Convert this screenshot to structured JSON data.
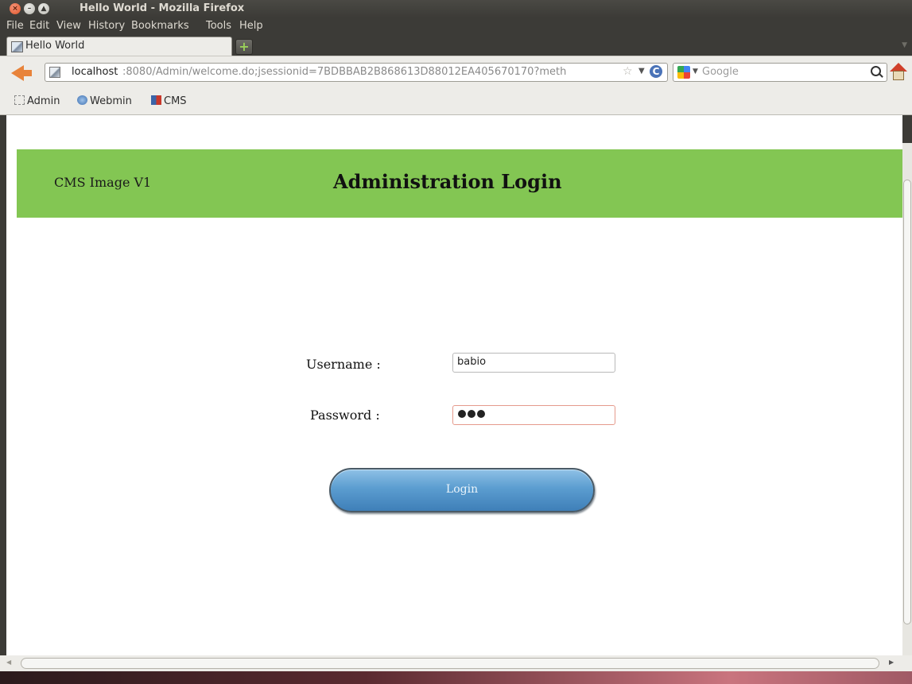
{
  "window": {
    "title": "Hello World - Mozilla Firefox"
  },
  "menu": [
    "File",
    "Edit",
    "View",
    "History",
    "Bookmarks",
    "Tools",
    "Help"
  ],
  "tab": {
    "label": "Hello World"
  },
  "urlbar": {
    "host": "localhost",
    "path": ":8080/Admin/welcome.do;jsessionid=7BDBBAB2B868613D88012EA405670170?meth"
  },
  "search": {
    "placeholder": "Google"
  },
  "bookmarks": [
    "Admin",
    "Webmin",
    "CMS"
  ],
  "page": {
    "brand": "CMS Image V1",
    "heading": "Administration Login",
    "username_label": "Username :",
    "username_value": "babio",
    "password_label": "Password :",
    "password_masked_length": 3,
    "login_label": "Login"
  },
  "colors": {
    "banner": "#83c653",
    "button": "#5b9dd0"
  }
}
